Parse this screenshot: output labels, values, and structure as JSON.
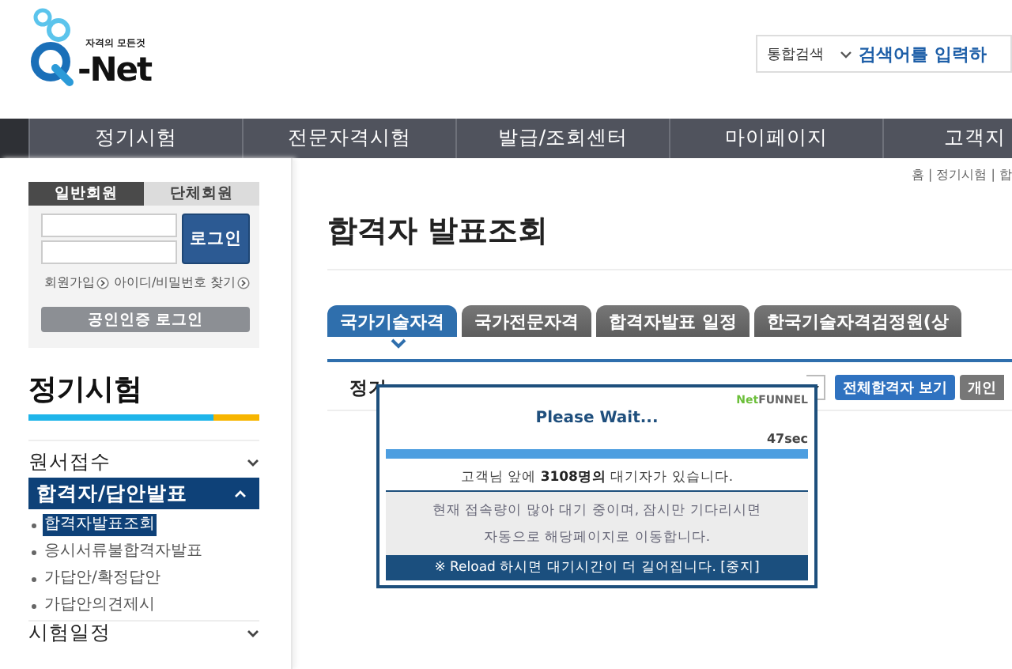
{
  "header": {
    "logo": {
      "tagline": "자격의 모든것",
      "name": "-Net"
    },
    "search": {
      "scope": "통합검색",
      "placeholder": "검색어를 입력하"
    }
  },
  "nav": [
    "정기시험",
    "전문자격시험",
    "발급/조회센터",
    "마이페이지",
    "고객지"
  ],
  "login": {
    "tabs": [
      {
        "label": "일반회원",
        "selected": true
      },
      {
        "label": "단체회원",
        "selected": false
      }
    ],
    "submit": "로그인",
    "links": [
      "회원가입",
      "아이디/비밀번호 찾기"
    ],
    "cert_login": "공인인증 로그인"
  },
  "sidebar": {
    "title": "정기시험",
    "menu": [
      {
        "label": "원서접수",
        "expanded": false,
        "selected": false
      },
      {
        "label": "합격자/답안발표",
        "expanded": true,
        "selected": true,
        "children": [
          {
            "label": "합격자발표조회",
            "selected": true
          },
          {
            "label": "응시서류불합격자발표",
            "selected": false
          },
          {
            "label": "가답안/확정답안",
            "selected": false
          },
          {
            "label": "가답안의견제시",
            "selected": false
          }
        ]
      },
      {
        "label": "시험일정",
        "expanded": false,
        "selected": false
      }
    ]
  },
  "breadcrumb": "홈 | 정기시험 | 합",
  "page_title": "합격자 발표조회",
  "tabs": [
    {
      "label": "국가기술자격",
      "selected": true
    },
    {
      "label": "국가전문자격",
      "selected": false
    },
    {
      "label": "합격자발표 일정",
      "selected": false
    },
    {
      "label": "한국기술자격검정원(상",
      "selected": false
    }
  ],
  "filter": {
    "label": "정기",
    "buttons": [
      {
        "label": "전체합격자 보기",
        "kind": "primary"
      },
      {
        "label": "개인",
        "kind": "secondary"
      }
    ]
  },
  "wait_dialog": {
    "brand_prefix": "Net",
    "brand": "FUNNEL",
    "title": "Please Wait...",
    "remaining": "47sec",
    "level": 1,
    "queue_message": "고객님 앞에 **3108명의** 대기자가 있습니다.",
    "notice_lines": [
      "현재 접속량이 많아 대기 중이며, 잠시만 기다리시면",
      "자동으로 해당페이지로 이동합니다."
    ],
    "reload_warning": "※ Reload 하시면 대기시간이 더 길어집니다. [중지]"
  }
}
